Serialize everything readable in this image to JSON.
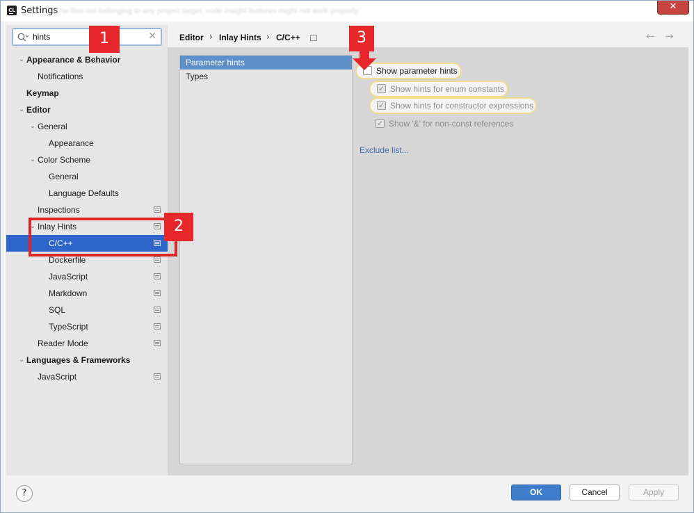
{
  "window": {
    "title": "Settings",
    "title_subtext": "The files not belonging to any project target, code insight features might not work properly.",
    "close_symbol": "✕"
  },
  "search": {
    "value": "hints",
    "clear_symbol": "✕"
  },
  "tree": [
    {
      "label": "Appearance & Behavior",
      "bold": true,
      "level": 0,
      "expanded": true
    },
    {
      "label": "Notifications",
      "bold": false,
      "level": 1
    },
    {
      "label": "Keymap",
      "bold": true,
      "level": 0
    },
    {
      "label": "Editor",
      "bold": true,
      "level": 0,
      "expanded": true
    },
    {
      "label": "General",
      "bold": false,
      "level": 1,
      "expanded": true
    },
    {
      "label": "Appearance",
      "bold": false,
      "level": 2
    },
    {
      "label": "Color Scheme",
      "bold": false,
      "level": 1,
      "expanded": true
    },
    {
      "label": "General",
      "bold": false,
      "level": 2
    },
    {
      "label": "Language Defaults",
      "bold": false,
      "level": 2
    },
    {
      "label": "Inspections",
      "bold": false,
      "level": 1,
      "page_icon": true
    },
    {
      "label": "Inlay Hints",
      "bold": false,
      "level": 1,
      "expanded": true,
      "page_icon": true
    },
    {
      "label": "C/C++",
      "bold": false,
      "level": 2,
      "selected": true,
      "page_icon": true
    },
    {
      "label": "Dockerfile",
      "bold": false,
      "level": 2,
      "page_icon": true
    },
    {
      "label": "JavaScript",
      "bold": false,
      "level": 2,
      "page_icon": true
    },
    {
      "label": "Markdown",
      "bold": false,
      "level": 2,
      "page_icon": true
    },
    {
      "label": "SQL",
      "bold": false,
      "level": 2,
      "page_icon": true
    },
    {
      "label": "TypeScript",
      "bold": false,
      "level": 2,
      "page_icon": true
    },
    {
      "label": "Reader Mode",
      "bold": false,
      "level": 1,
      "page_icon": true
    },
    {
      "label": "Languages & Frameworks",
      "bold": true,
      "level": 0,
      "expanded": true
    },
    {
      "label": "JavaScript",
      "bold": false,
      "level": 1,
      "page_icon": true
    }
  ],
  "breadcrumb": {
    "items": [
      "Editor",
      "Inlay Hints",
      "C/C++"
    ],
    "separator": "›",
    "back": "←",
    "forward": "→"
  },
  "hint_types": [
    {
      "label": "Parameter hints",
      "selected": true
    },
    {
      "label": "Types",
      "selected": false
    }
  ],
  "options": {
    "show_parameter_hints": {
      "label": "Show parameter hints",
      "checked": false
    },
    "enum_constants": {
      "label": "Show hints for enum constants",
      "checked": true
    },
    "constructor_expressions": {
      "label": "Show hints for constructor expressions",
      "checked": true
    },
    "non_const_references": {
      "label": "Show '&' for non-const references",
      "checked": true
    }
  },
  "exclude_link": "Exclude list...",
  "footer": {
    "help": "?",
    "ok": "OK",
    "cancel": "Cancel",
    "apply": "Apply"
  },
  "annotations": {
    "badge1": "1",
    "badge2": "2",
    "badge3": "3",
    "color": "#e8272c"
  }
}
